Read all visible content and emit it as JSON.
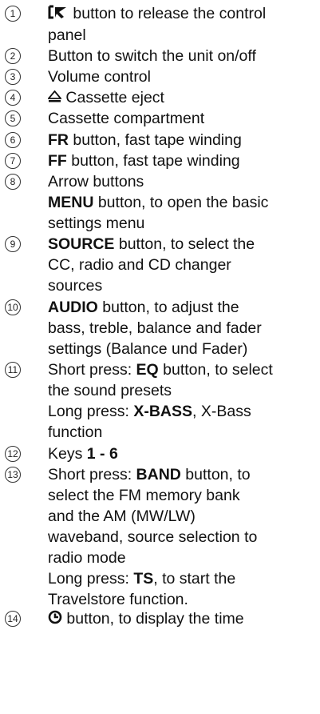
{
  "items": [
    {
      "num": "1",
      "lines": [
        {
          "icon": "release-panel-icon",
          "rest": " button to release the control"
        },
        {
          "text": "panel"
        }
      ]
    },
    {
      "num": "2",
      "lines": [
        {
          "text": "Button to switch the unit on/off"
        }
      ]
    },
    {
      "num": "3",
      "lines": [
        {
          "text": "Volume control"
        }
      ]
    },
    {
      "num": "4",
      "lines": [
        {
          "icon": "eject-icon",
          "rest": " Cassette eject"
        }
      ]
    },
    {
      "num": "5",
      "lines": [
        {
          "text": "Cassette compartment"
        }
      ]
    },
    {
      "num": "6",
      "lines": [
        {
          "bold": "FR",
          "rest": " button, fast tape winding"
        }
      ]
    },
    {
      "num": "7",
      "lines": [
        {
          "bold": "FF",
          "rest": " button, fast tape winding"
        }
      ]
    },
    {
      "num": "8",
      "lines": [
        {
          "text": "Arrow buttons"
        },
        {
          "bold": "MENU",
          "rest": " button, to open the basic"
        },
        {
          "text": "settings menu"
        }
      ]
    },
    {
      "num": "9",
      "lines": [
        {
          "bold": "SOURCE",
          "rest": " button, to select the"
        },
        {
          "text": "CC, radio and CD changer"
        },
        {
          "text": "sources"
        }
      ]
    },
    {
      "num": "10",
      "lines": [
        {
          "bold": "AUDIO",
          "rest": " button, to adjust the"
        },
        {
          "text": "bass, treble, balance and fader"
        },
        {
          "text": "settings (Balance und Fader)"
        }
      ]
    },
    {
      "num": "11",
      "lines": [
        {
          "pre": "Short press: ",
          "bold": "EQ",
          "rest": " button, to select"
        },
        {
          "text": "the sound presets"
        },
        {
          "pre": "Long press: ",
          "bold": "X-BASS",
          "rest": ", X-Bass"
        },
        {
          "text": "function"
        }
      ]
    },
    {
      "num": "12",
      "lines": [
        {
          "pre": "Keys ",
          "bold": "1 - 6"
        }
      ]
    },
    {
      "num": "13",
      "lines": [
        {
          "pre": "Short press: ",
          "bold": "BAND",
          "rest": " button, to"
        },
        {
          "text": "select the FM memory bank"
        },
        {
          "text": "and the AM (MW/LW)"
        },
        {
          "text": "waveband, source selection to"
        },
        {
          "text": "radio mode"
        },
        {
          "pre": "Long press: ",
          "bold": "TS",
          "rest": ", to start the"
        },
        {
          "text": "Travelstore function."
        }
      ]
    },
    {
      "num": "14",
      "lines": [
        {
          "icon": "clock-icon",
          "rest": " button, to display the time"
        }
      ]
    }
  ]
}
